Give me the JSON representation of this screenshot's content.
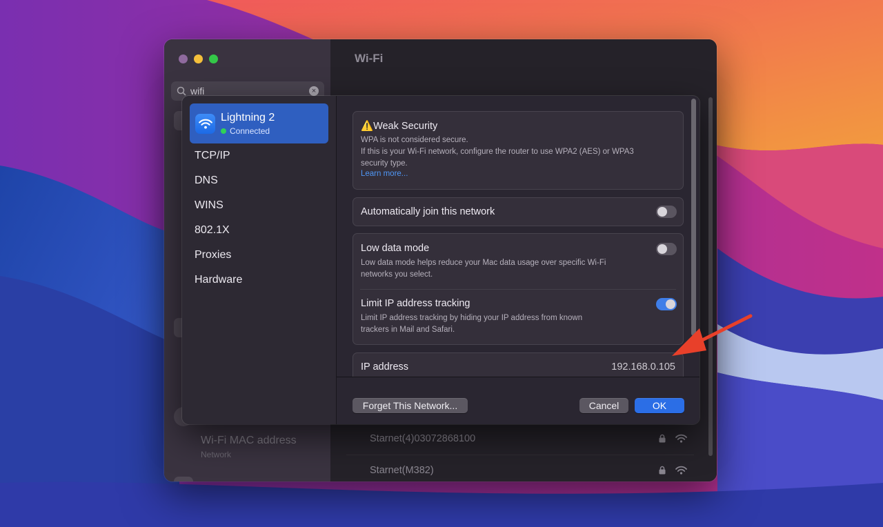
{
  "background_window": {
    "search": {
      "value": "wifi"
    },
    "title": "Wi-Fi",
    "mac_item": {
      "title": "Wi-Fi MAC address",
      "subtitle": "Network"
    },
    "networks": [
      {
        "name": "Starnet(4)03072868100"
      },
      {
        "name": "Starnet(M382)"
      }
    ]
  },
  "sheet": {
    "network": {
      "name": "Lightning 2",
      "status": "Connected"
    },
    "menu": [
      "TCP/IP",
      "DNS",
      "WINS",
      "802.1X",
      "Proxies",
      "Hardware"
    ],
    "security": {
      "icon": "⚠️",
      "title": "Weak Security",
      "line1": "WPA is not considered secure.",
      "line2": "If this is your Wi-Fi network, configure the router to use WPA2 (AES) or WPA3",
      "line3": "security type.",
      "link": "Learn more..."
    },
    "auto_join": {
      "label": "Automatically join this network",
      "enabled": false
    },
    "low_data": {
      "label": "Low data mode",
      "desc1": "Low data mode helps reduce your Mac data usage over specific Wi-Fi",
      "desc2": "networks you select.",
      "enabled": false
    },
    "limit_ip": {
      "label": "Limit IP address tracking",
      "desc1": "Limit IP address tracking by hiding your IP address from known",
      "desc2": "trackers in Mail and Safari.",
      "enabled": true
    },
    "ip": {
      "label": "IP address",
      "value": "192.168.0.105"
    },
    "buttons": {
      "forget": "Forget This Network...",
      "cancel": "Cancel",
      "ok": "OK"
    }
  },
  "colors": {
    "accent": "#2b6ee6",
    "annotation_arrow": "#e8402a",
    "connected": "#30d158"
  }
}
